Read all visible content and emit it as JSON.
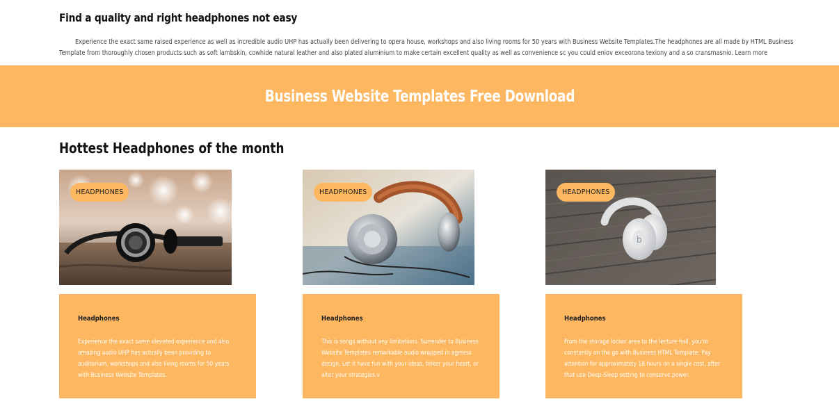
{
  "intro": {
    "title": "Find a quality and right headphones not easy",
    "text": "Experience the exact same raised experience as well as incredible audio UHP has actually been delivering to opera house, workshops and also living rooms for 50 years with Business Website Templates.The headphones are all made by HTML Business Template from thoroughly chosen products such as soft lambskin, cowhide natural leather and also plated aluminium to make certain excellent quality as well as convenience sc you could eniov exceorona texiony and a so cransmasnio.",
    "link": "Learn more"
  },
  "banner": {
    "title": "Business Website Templates Free Download",
    "color": "#fdb760"
  },
  "section": {
    "title": "Hottest Headphones of the month"
  },
  "cards": [
    {
      "tag": "HEADPHONES",
      "image": "black-headphones-on-table-bokeh",
      "heading": "Headphones",
      "text": "Experience the exact same elevated experience and also amazing audio UHP has actually been providing to auditorium, workshops and also living rooms for 50 years with Business Website Templates."
    },
    {
      "tag": "HEADPHONES",
      "image": "silver-brown-headphones-closeup",
      "heading": "Headphones",
      "text": "This is songs without any limitations. Surrender to Business Website Templates remarkable audio wrapped in ageless design. Let it have fun with your ideas, tinker your heart, or alter your strategies.v"
    },
    {
      "tag": "HEADPHONES",
      "image": "white-headphones-on-wood",
      "heading": "Headphones",
      "text": "From the storage locker area to the lecture hall, you're constantly on the go with Business HTML Template. Pay attention for approximately 18 hours on a single cost, after that use Deep-Sleep setting to conserve power."
    }
  ]
}
